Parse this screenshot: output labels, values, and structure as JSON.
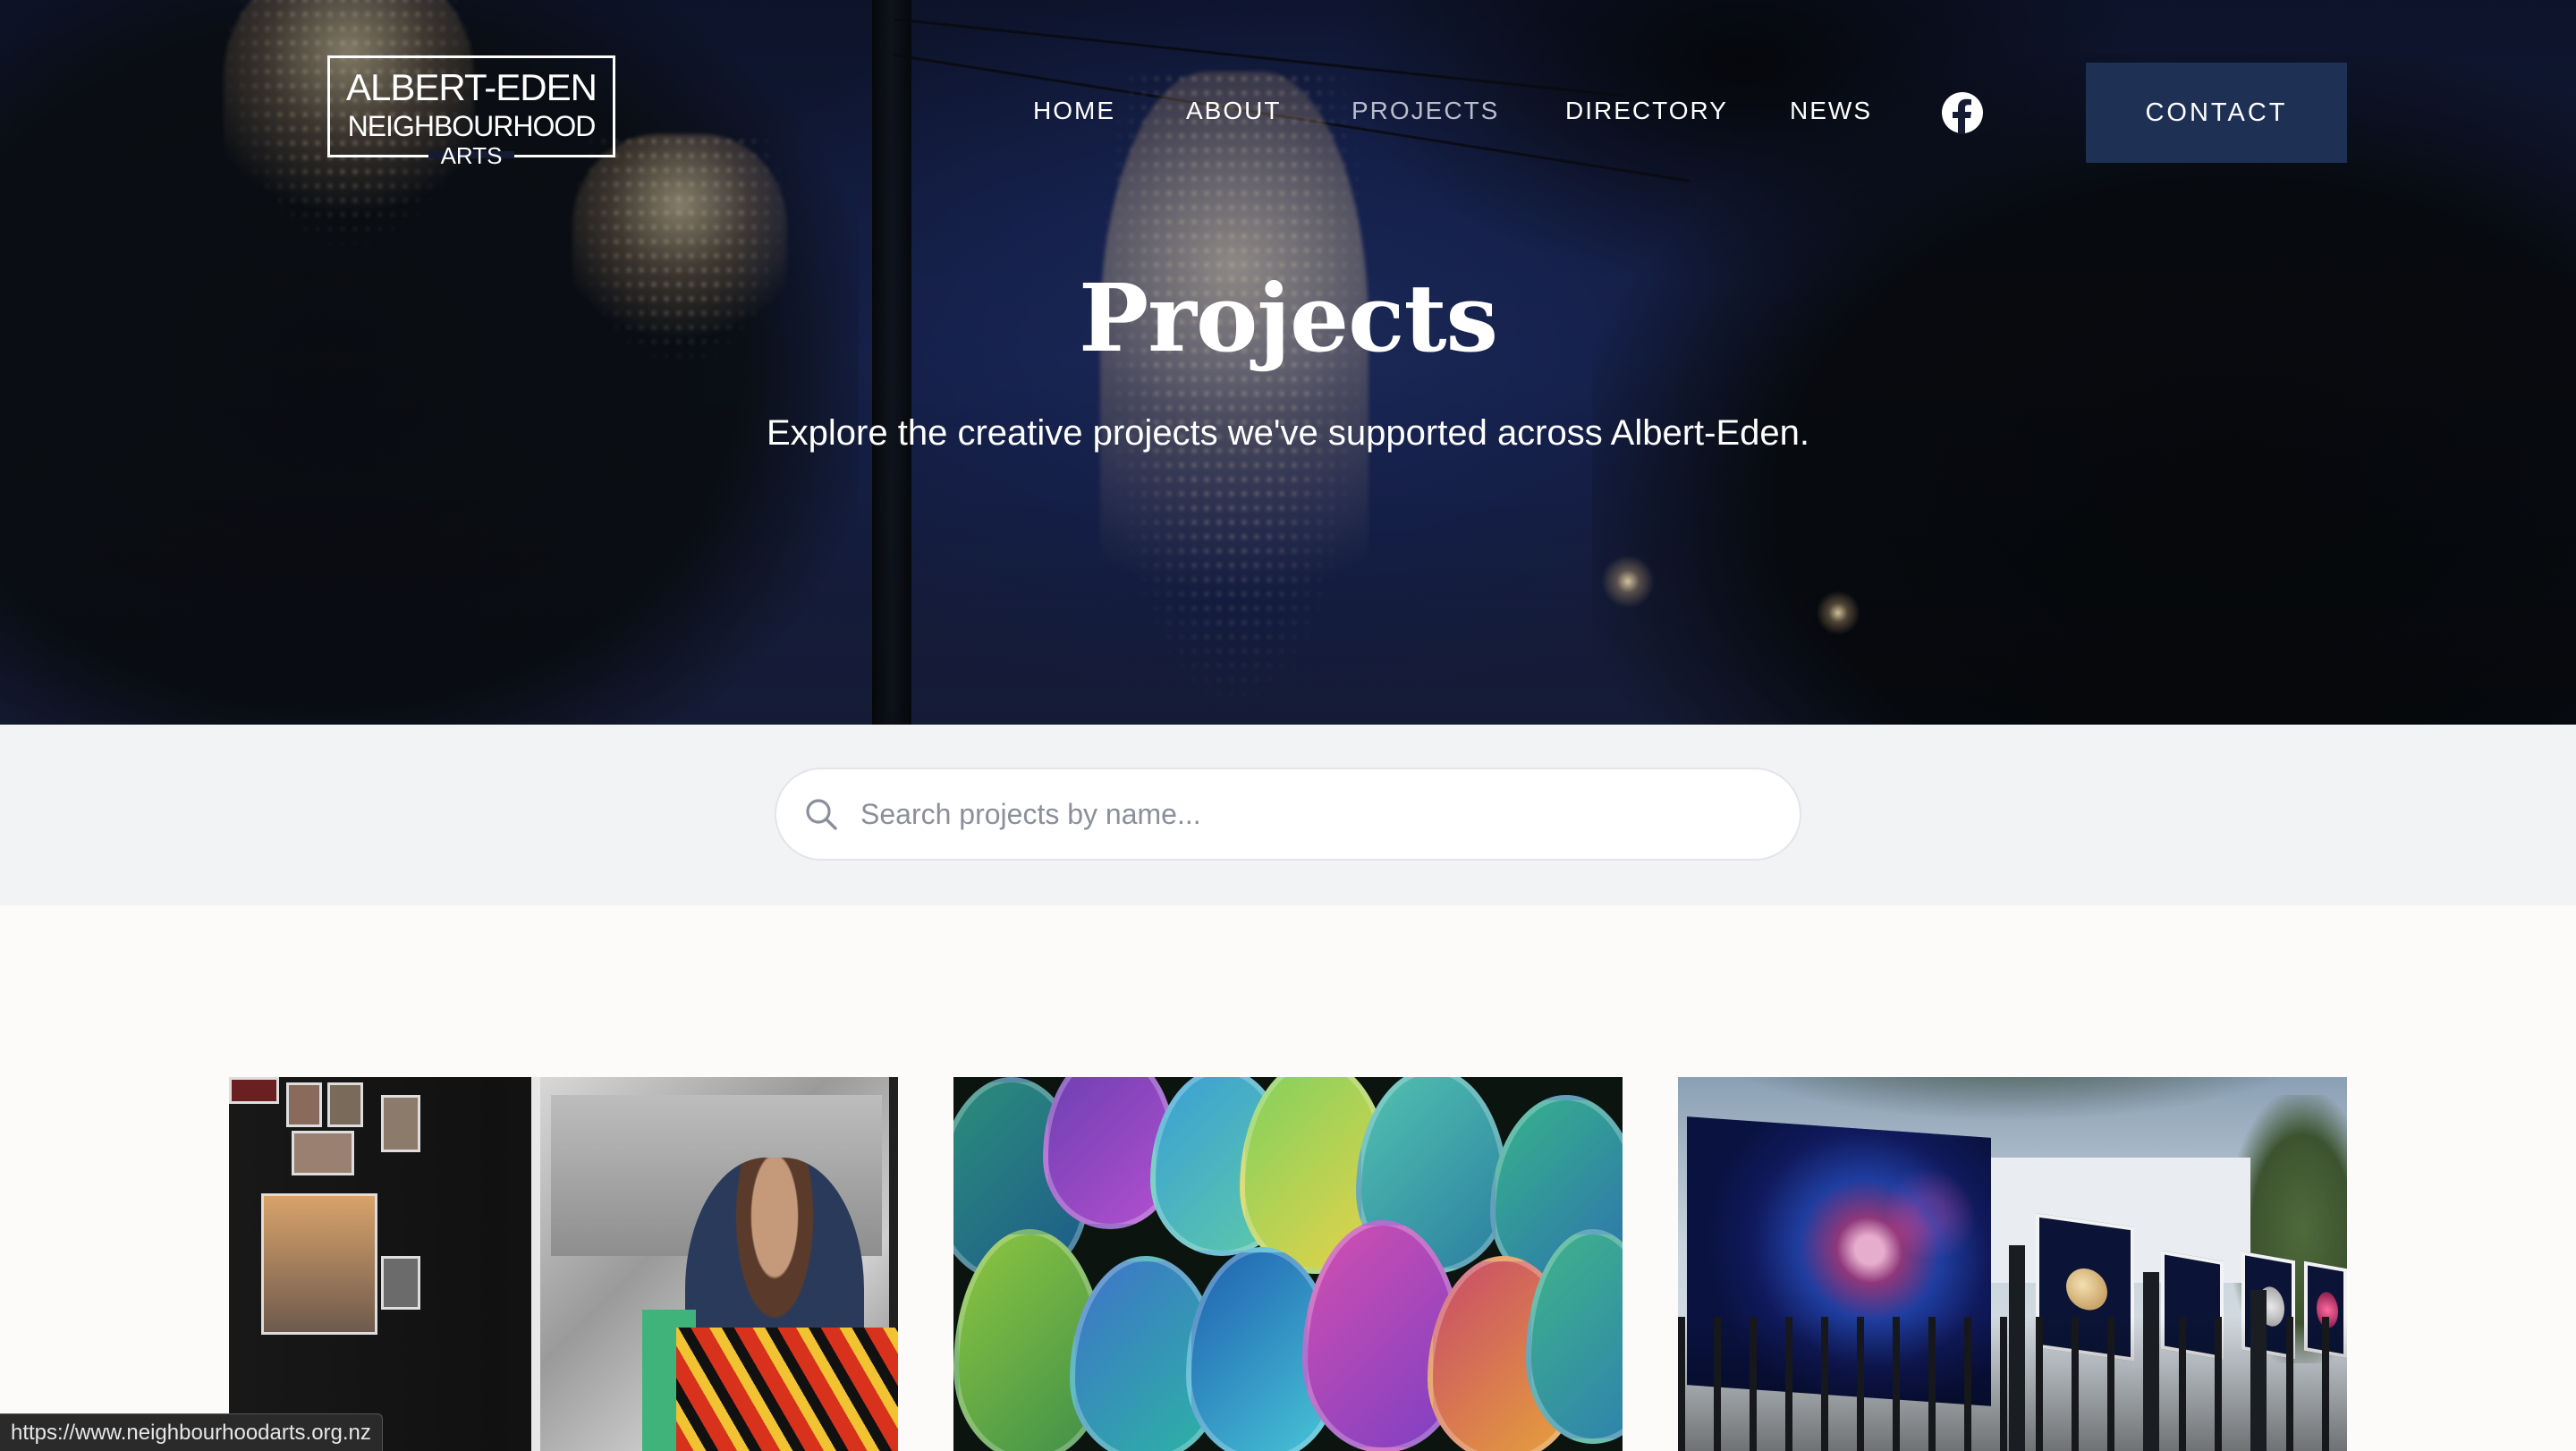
{
  "site": {
    "logo": {
      "line1": "ALBERT-EDEN",
      "line2": "NEIGHBOURHOOD",
      "line3": "ARTS"
    }
  },
  "nav": {
    "items": [
      {
        "label": "HOME",
        "active": false
      },
      {
        "label": "ABOUT",
        "active": false
      },
      {
        "label": "PROJECTS",
        "active": true
      },
      {
        "label": "DIRECTORY",
        "active": false
      },
      {
        "label": "NEWS",
        "active": false
      }
    ],
    "social_icon": "facebook-icon",
    "contact_label": "CONTACT"
  },
  "hero": {
    "title": "Projects",
    "subtitle": "Explore the creative projects we've supported across Albert-Eden."
  },
  "search": {
    "placeholder": "Search projects by name...",
    "value": ""
  },
  "status_bar": {
    "url": "https://www.neighbourhoodarts.org.nz"
  },
  "colors": {
    "contact_button": "#1f3055",
    "active_nav": "#b9bccb",
    "search_band": "#f2f3f5"
  }
}
